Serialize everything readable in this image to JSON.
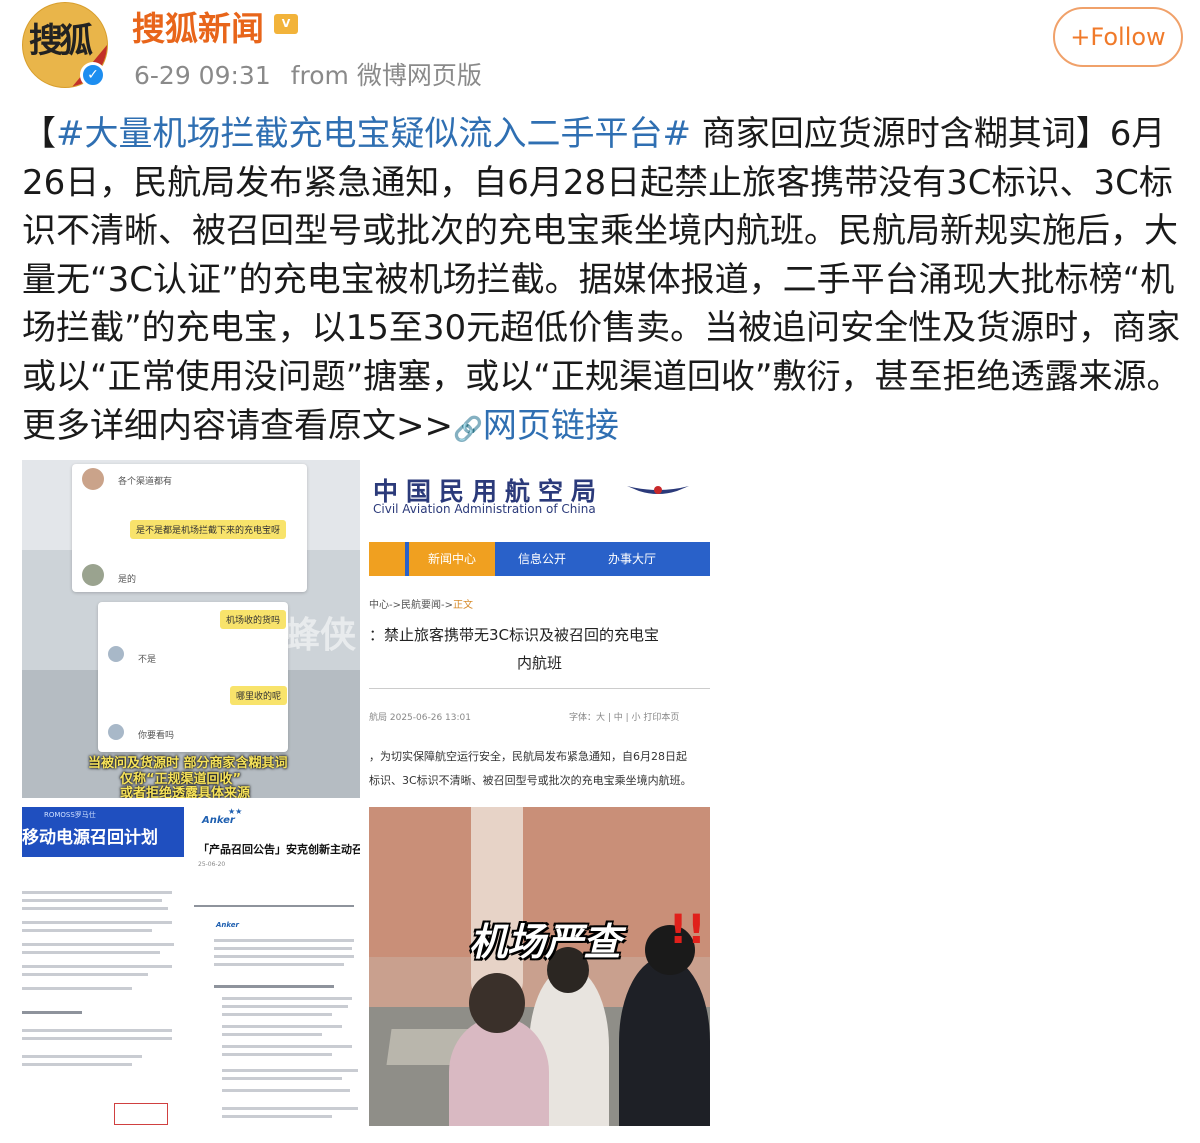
{
  "account": {
    "name": "搜狐新闻",
    "avatar_text": "搜狐",
    "verified_mark": "✓",
    "badge": "V"
  },
  "meta": {
    "time": "6-29 09:31",
    "source": "from 微博网页版"
  },
  "follow_button": {
    "label": "+Follow"
  },
  "post": {
    "bracket_open": "【",
    "hashtag": "#大量机场拦截充电宝疑似流入二手平台#",
    "headline_rest": " 商家回应货源时含糊其词】",
    "body": "6月26日，民航局发布紧急通知，自6月28日起禁止旅客携带没有3C标识、3C标识不清晰、被召回型号或批次的充电宝乘坐境内航班。民航局新规实施后，大量无“3C认证”的充电宝被机场拦截。据媒体报道，二手平台涌现大批标榜“机场拦截”的充电宝，以15至30元超低价售卖。当被追问安全性及货源时，商家或以“正常使用没问题”搪塞，或以“正规渠道回收”敷衍，甚至拒绝透露来源。更多详细内容请查看原文>>",
    "link_icon": "link-icon",
    "link_label": "网页链接"
  },
  "images": {
    "chat": {
      "msg1": "各个渠道都有",
      "msg2": "是不是都是机场拦截下来的充电宝呀",
      "msg3": "是的",
      "msg4": "机场收的货吗",
      "msg5": "不是",
      "msg6": "哪里收的呢",
      "msg7": "你要看吗",
      "caption1": "当被问及货源时 部分商家含糊其词",
      "caption2": "仅称“正规渠道回收”",
      "caption3": "或者拒绝透露具体来源",
      "watermark": "蜂侠"
    },
    "caac": {
      "title": "中国民用航空局",
      "subtitle": "Civil Aviation Administration of China",
      "nav": [
        "新闻中心",
        "信息公开",
        "办事大厅"
      ],
      "crumb_prefix": "中心->民航要闻->",
      "crumb_current": "正文",
      "article_title_line1": "禁止旅客携带无3C标识及被召回的充电宝",
      "article_title_line2": "内航班",
      "article_meta": "航局   2025-06-26 13:01",
      "article_tools": "字体：大 | 中 | 小   打印本页",
      "body_line1": "，为切实保障航空运行安全，民航局发布紧急通知，自6月28日起",
      "body_line2": "标识、3C标识不清晰、被召回型号或批次的充电宝乘坐境内航班。"
    },
    "recall": {
      "romoss_brand": "ROMOSS罗马仕",
      "romoss_title": "移动电源召回计划",
      "anker_logo": "Anker",
      "anker_title": "「产品召回公告」安克创新主动召回",
      "anker_date": "25-06-20"
    },
    "airport": {
      "caption": "机场严查",
      "exclaim": "!!"
    }
  }
}
